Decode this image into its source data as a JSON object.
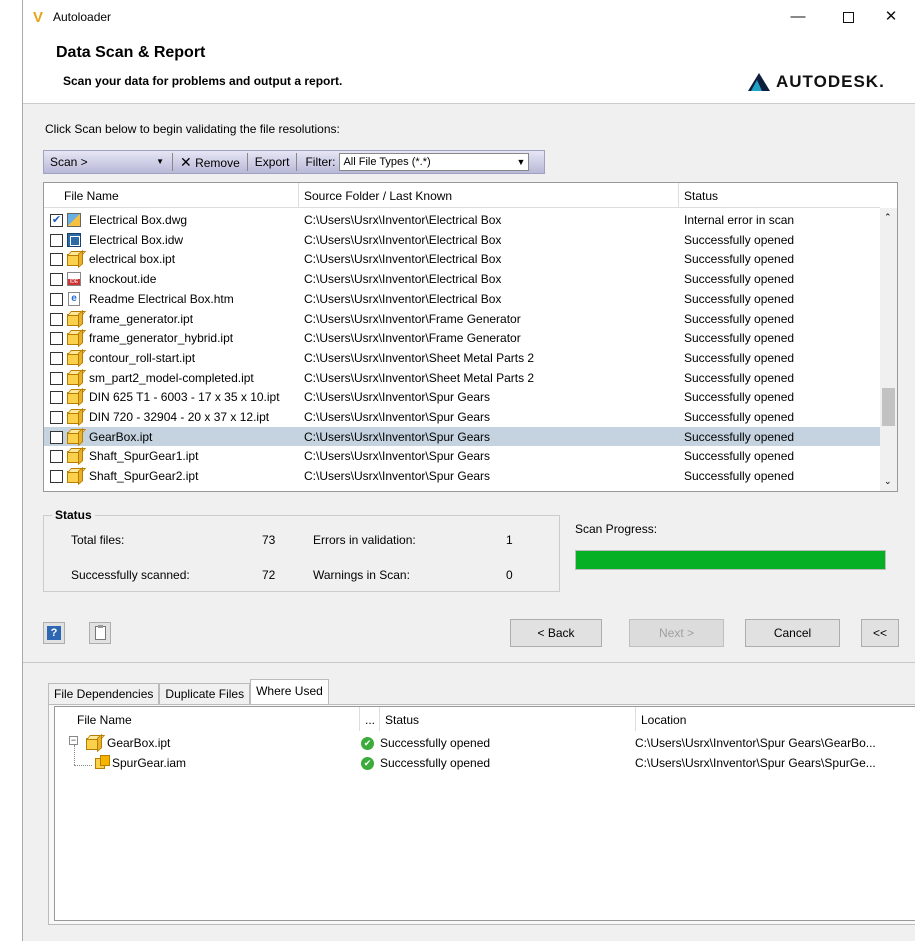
{
  "window": {
    "app_icon": "V",
    "title": "Autoloader",
    "minimize": "—",
    "close": "✕"
  },
  "header": {
    "title": "Data Scan & Report",
    "subtitle": "Scan your data for problems and output a report.",
    "logo_text": "AUTODESK."
  },
  "instruction": "Click Scan below to begin validating the file resolutions:",
  "toolbar": {
    "scan": "Scan >",
    "remove": "Remove",
    "export": "Export",
    "filter_label": "Filter:",
    "filter_value": "All File Types (*.*)"
  },
  "file_table": {
    "columns": [
      "File Name",
      "Source Folder / Last Known",
      "Status"
    ],
    "rows": [
      {
        "checked": true,
        "icon": "dwg-icon",
        "name": "Electrical Box.dwg",
        "source": "C:\\Users\\Usrx\\Inventor\\Electrical Box",
        "status": "Internal error in scan"
      },
      {
        "checked": false,
        "icon": "idw-icon",
        "name": "Electrical Box.idw",
        "source": "C:\\Users\\Usrx\\Inventor\\Electrical Box",
        "status": "Successfully opened"
      },
      {
        "checked": false,
        "icon": "part-icon",
        "name": "electrical box.ipt",
        "source": "C:\\Users\\Usrx\\Inventor\\Electrical Box",
        "status": "Successfully opened"
      },
      {
        "checked": false,
        "icon": "ide-icon",
        "name": "knockout.ide",
        "source": "C:\\Users\\Usrx\\Inventor\\Electrical Box",
        "status": "Successfully opened"
      },
      {
        "checked": false,
        "icon": "htm-icon",
        "name": "Readme Electrical Box.htm",
        "source": "C:\\Users\\Usrx\\Inventor\\Electrical Box",
        "status": "Successfully opened"
      },
      {
        "checked": false,
        "icon": "part-icon",
        "name": "frame_generator.ipt",
        "source": "C:\\Users\\Usrx\\Inventor\\Frame Generator",
        "status": "Successfully opened"
      },
      {
        "checked": false,
        "icon": "part-icon",
        "name": "frame_generator_hybrid.ipt",
        "source": "C:\\Users\\Usrx\\Inventor\\Frame Generator",
        "status": "Successfully opened"
      },
      {
        "checked": false,
        "icon": "part-icon",
        "name": "contour_roll-start.ipt",
        "source": "C:\\Users\\Usrx\\Inventor\\Sheet Metal Parts 2",
        "status": "Successfully opened"
      },
      {
        "checked": false,
        "icon": "part-icon",
        "name": "sm_part2_model-completed.ipt",
        "source": "C:\\Users\\Usrx\\Inventor\\Sheet Metal Parts 2",
        "status": "Successfully opened"
      },
      {
        "checked": false,
        "icon": "part-icon",
        "name": "DIN 625 T1 - 6003 - 17 x 35 x 10.ipt",
        "source": "C:\\Users\\Usrx\\Inventor\\Spur Gears",
        "status": "Successfully opened"
      },
      {
        "checked": false,
        "icon": "part-icon",
        "name": "DIN 720 - 32904 - 20 x 37 x 12.ipt",
        "source": "C:\\Users\\Usrx\\Inventor\\Spur Gears",
        "status": "Successfully opened"
      },
      {
        "checked": false,
        "icon": "part-icon",
        "name": "GearBox.ipt",
        "source": "C:\\Users\\Usrx\\Inventor\\Spur Gears",
        "status": "Successfully opened",
        "selected": true
      },
      {
        "checked": false,
        "icon": "part-icon",
        "name": "Shaft_SpurGear1.ipt",
        "source": "C:\\Users\\Usrx\\Inventor\\Spur Gears",
        "status": "Successfully opened"
      },
      {
        "checked": false,
        "icon": "part-icon",
        "name": "Shaft_SpurGear2.ipt",
        "source": "C:\\Users\\Usrx\\Inventor\\Spur Gears",
        "status": "Successfully opened"
      }
    ]
  },
  "status": {
    "title": "Status",
    "total_label": "Total files:",
    "total_value": "73",
    "scanned_label": "Successfully scanned:",
    "scanned_value": "72",
    "errors_label": "Errors in validation:",
    "errors_value": "1",
    "warnings_label": "Warnings in Scan:",
    "warnings_value": "0"
  },
  "scan_progress": {
    "label": "Scan Progress:",
    "fraction": 1.0
  },
  "buttons": {
    "help": "?",
    "back": "< Back",
    "next": "Next >",
    "cancel": "Cancel",
    "collapse": "<<"
  },
  "tabs": [
    "File Dependencies",
    "Duplicate Files",
    "Where Used"
  ],
  "active_tab": "Where Used",
  "where_used": {
    "columns": [
      "File Name",
      "...",
      "Status",
      "Location"
    ],
    "rows": [
      {
        "name": "GearBox.ipt",
        "status": "Successfully opened",
        "location": "C:\\Users\\Usrx\\Inventor\\Spur Gears\\GearBo..."
      },
      {
        "name": "SpurGear.iam",
        "status": "Successfully opened",
        "location": "C:\\Users\\Usrx\\Inventor\\Spur Gears\\SpurGe..."
      }
    ]
  },
  "colors": {
    "progress": "#06b025",
    "selected_row": "#c5d3e0",
    "toolbar": "#b8b8d8"
  }
}
